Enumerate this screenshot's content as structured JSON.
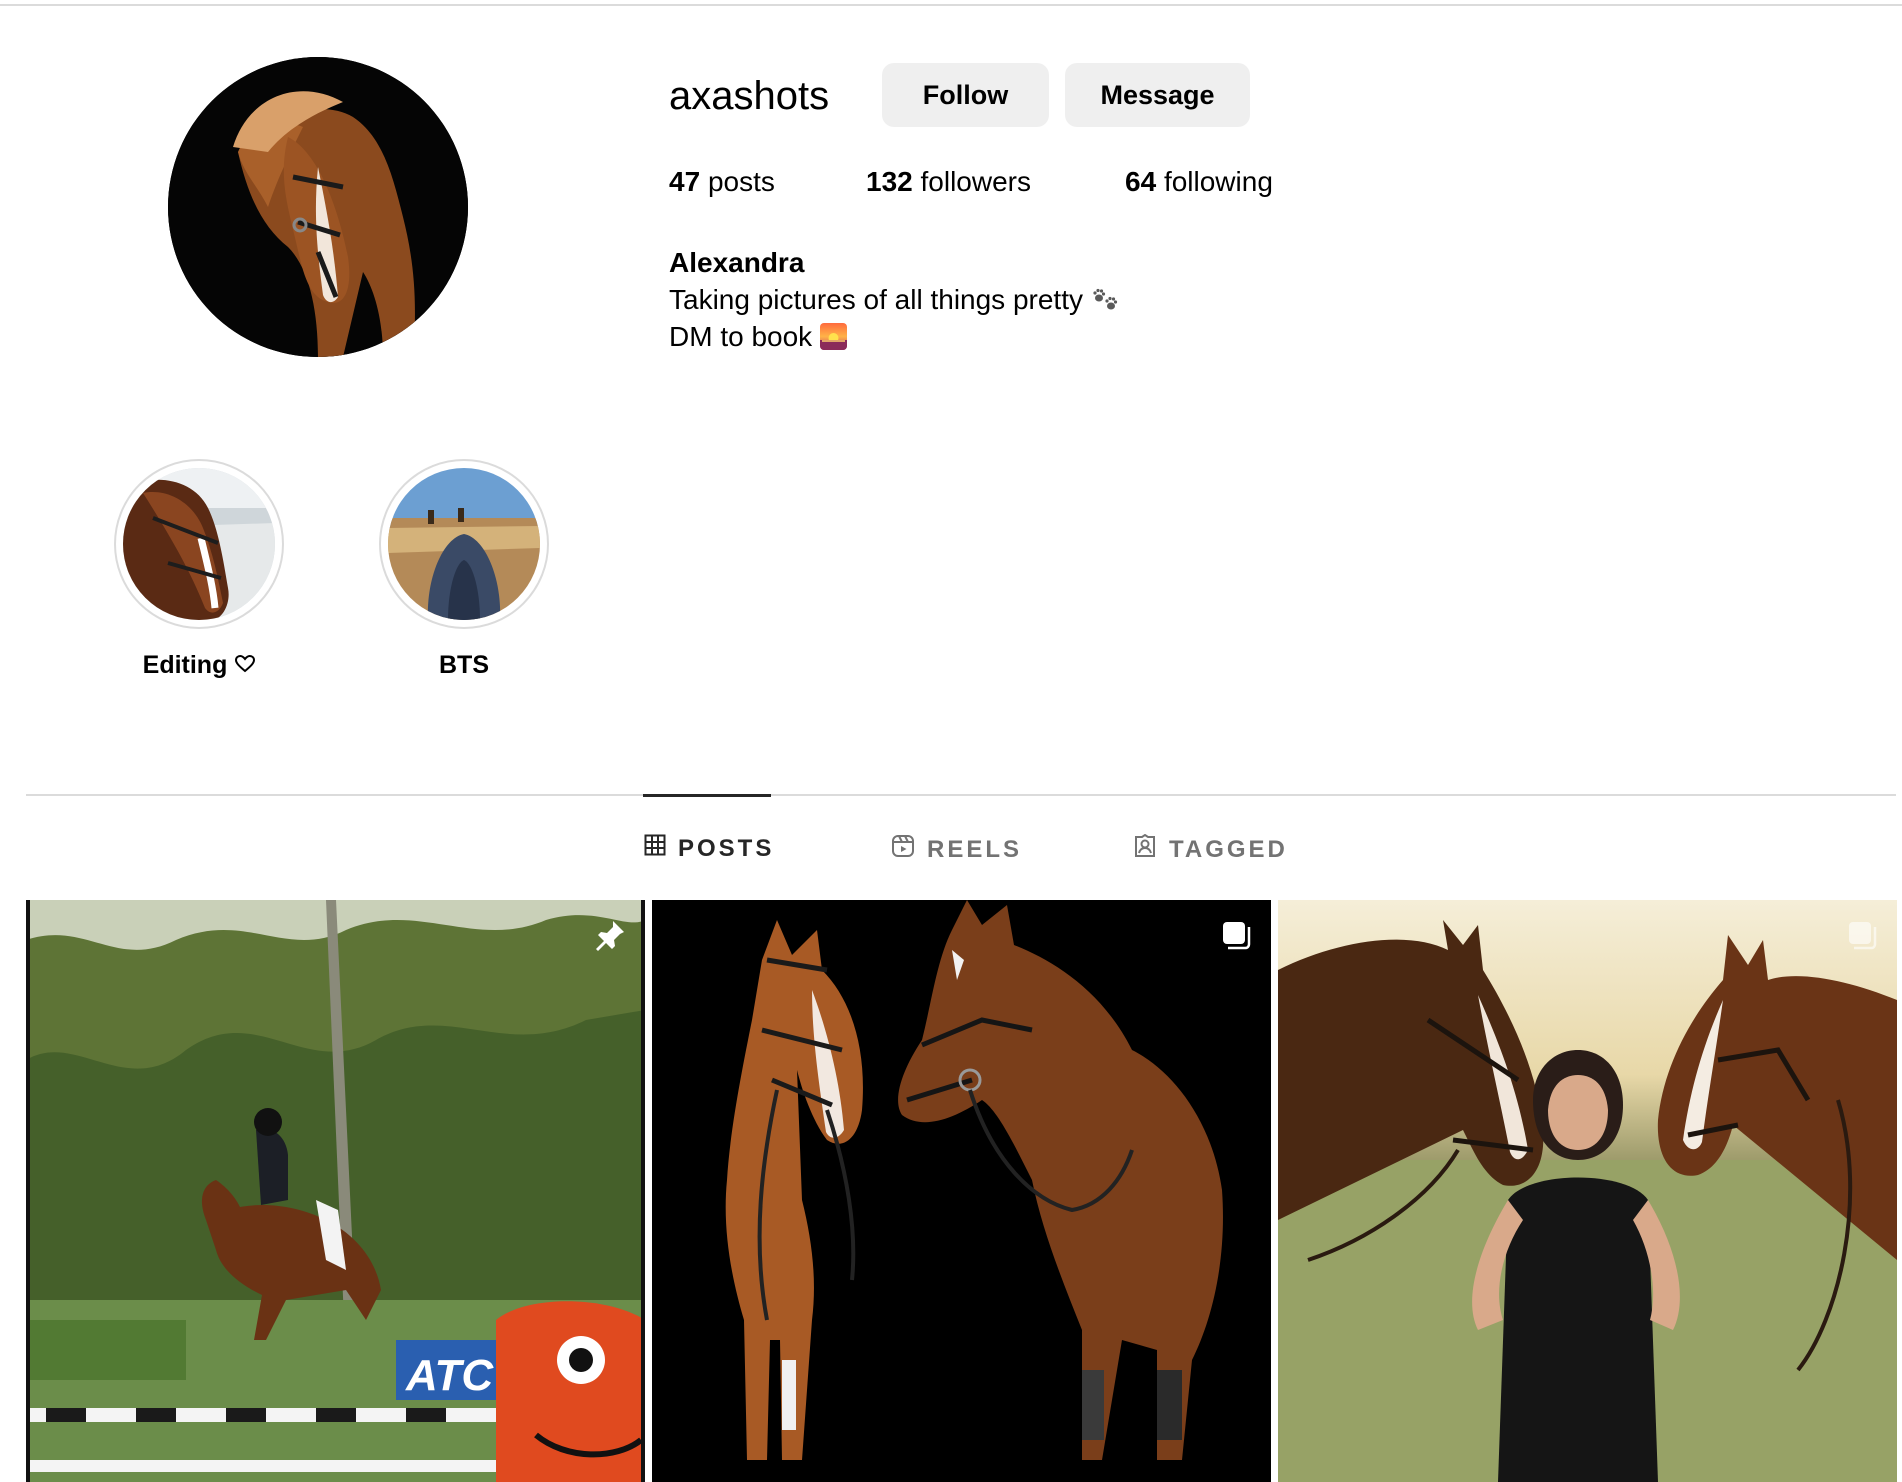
{
  "profile": {
    "username": "axashots",
    "follow_label": "Follow",
    "message_label": "Message",
    "stats": {
      "posts_count": "47",
      "posts_label": "posts",
      "followers_count": "132",
      "followers_label": "followers",
      "following_count": "64",
      "following_label": "following"
    },
    "bio": {
      "name": "Alexandra",
      "line1": "Taking pictures of all things pretty",
      "line1_emoji": "paw-prints-icon",
      "line2": "DM to book",
      "line2_emoji": "sunset-icon"
    }
  },
  "highlights": [
    {
      "label": "Editing",
      "icon": "heart-outline-icon"
    },
    {
      "label": "BTS"
    }
  ],
  "tabs": [
    {
      "label": "POSTS",
      "icon": "grid-icon",
      "active": true
    },
    {
      "label": "REELS",
      "icon": "reels-icon",
      "active": false
    },
    {
      "label": "TAGGED",
      "icon": "tagged-icon",
      "active": false
    }
  ],
  "posts": [
    {
      "subject": "rider jumping horse over fence",
      "badge": "pin-icon"
    },
    {
      "subject": "two horses touching noses on black background",
      "badge": "carousel-icon"
    },
    {
      "subject": "woman between two horses at sunset",
      "badge": "carousel-icon"
    }
  ],
  "colors": {
    "button_bg": "#efefef",
    "divider": "#dbdbdb",
    "active_tab": "#262626",
    "inactive_tab": "#737373"
  }
}
